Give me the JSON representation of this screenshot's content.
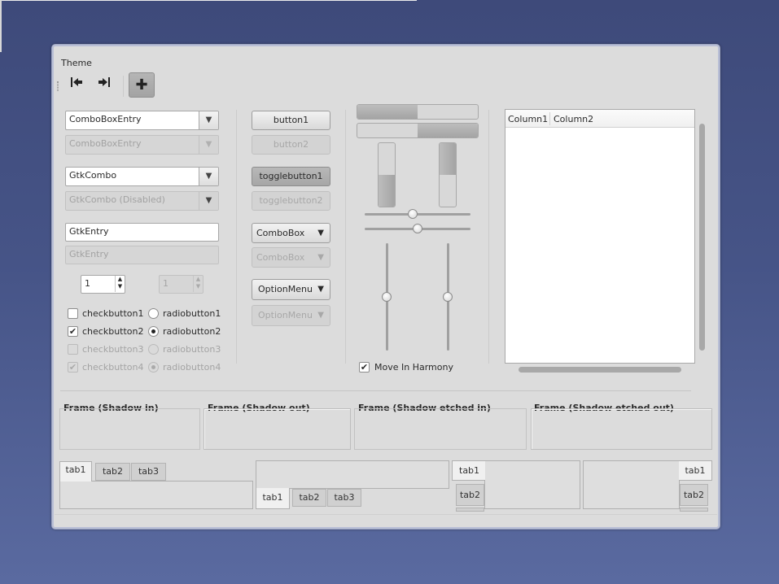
{
  "window": {
    "menu_label": "Theme"
  },
  "toolbar": {
    "first_icon": "goto-first-icon",
    "last_icon": "goto-last-icon",
    "add_icon": "plus-icon",
    "add_glyph": "✚"
  },
  "left": {
    "combo_entry": "ComboBoxEntry",
    "combo_entry_disabled": "ComboBoxEntry",
    "gtk_combo": "GtkCombo",
    "gtk_combo_disabled": "GtkCombo (Disabled)",
    "entry": "GtkEntry",
    "entry_disabled": "GtkEntry",
    "spin_value": "1",
    "spin_disabled_value": "1",
    "checkbuttons": [
      {
        "label": "checkbutton1",
        "checked": false,
        "disabled": false
      },
      {
        "label": "checkbutton2",
        "checked": true,
        "disabled": false
      },
      {
        "label": "checkbutton3",
        "checked": false,
        "disabled": true
      },
      {
        "label": "checkbutton4",
        "checked": true,
        "disabled": true
      }
    ],
    "radiobuttons": [
      {
        "label": "radiobutton1",
        "selected": false,
        "disabled": false
      },
      {
        "label": "radiobutton2",
        "selected": true,
        "disabled": false
      },
      {
        "label": "radiobutton3",
        "selected": false,
        "disabled": true
      },
      {
        "label": "radiobutton4",
        "selected": true,
        "disabled": true
      }
    ],
    "check_mark": "✔",
    "dropdown_arrow": "▼",
    "spin_up": "▲",
    "spin_down": "▼"
  },
  "middle": {
    "button1": "button1",
    "button2": "button2",
    "toggle1": "togglebutton1",
    "toggle2": "togglebutton2",
    "combobox": "ComboBox",
    "combobox_disabled": "ComboBox",
    "optionmenu": "OptionMenu",
    "optionmenu_disabled": "OptionMenu"
  },
  "sliders": {
    "progress_h1": 0.5,
    "progress_h2": 0.5,
    "progress_v1": 0.5,
    "progress_v2": 0.5,
    "hscale1": 0.45,
    "hscale2": 0.5,
    "vscale1": 0.5,
    "vscale2": 0.5,
    "harmony_label": "Move In Harmony",
    "harmony_checked": true
  },
  "tree": {
    "columns": [
      "Column1",
      "Column2"
    ]
  },
  "frames": [
    {
      "title": "Frame (Shadow in)"
    },
    {
      "title": "Frame (Shadow out)"
    },
    {
      "title": "Frame (Shadow etched in)"
    },
    {
      "title": "Frame (Shadow etched out)"
    }
  ],
  "notebooks": {
    "tabs": [
      "tab1",
      "tab2",
      "tab3"
    ]
  }
}
